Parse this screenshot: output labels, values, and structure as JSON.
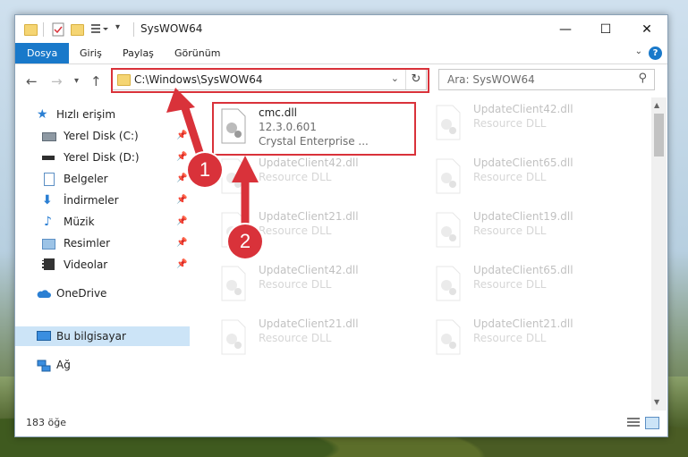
{
  "window": {
    "title": "SysWOW64",
    "buttons": {
      "minimize": "—",
      "maximize": "☐",
      "close": "✕"
    }
  },
  "ribbon": {
    "tabs": [
      "Dosya",
      "Giriş",
      "Paylaş",
      "Görünüm"
    ],
    "help": "?"
  },
  "address": {
    "path": "C:\\Windows\\SysWOW64",
    "search_placeholder": "Ara: SysWOW64"
  },
  "sidebar": {
    "items": [
      {
        "label": "Hızlı erişim",
        "icon": "star-icon",
        "pinned": false
      },
      {
        "label": "Yerel Disk (C:)",
        "icon": "drive-icon",
        "pinned": true
      },
      {
        "label": "Yerel Disk (D:)",
        "icon": "drive-icon",
        "pinned": true
      },
      {
        "label": "Belgeler",
        "icon": "documents-icon",
        "pinned": true
      },
      {
        "label": "İndirmeler",
        "icon": "downloads-icon",
        "pinned": true
      },
      {
        "label": "Müzik",
        "icon": "music-icon",
        "pinned": true
      },
      {
        "label": "Resimler",
        "icon": "pictures-icon",
        "pinned": true
      },
      {
        "label": "Videolar",
        "icon": "videos-icon",
        "pinned": true
      },
      {
        "label": "OneDrive",
        "icon": "cloud-icon",
        "pinned": false
      },
      {
        "label": "Bu bilgisayar",
        "icon": "computer-icon",
        "pinned": false
      },
      {
        "label": "Ağ",
        "icon": "network-icon",
        "pinned": false
      }
    ]
  },
  "files": {
    "highlighted": {
      "name": "cmc.dll",
      "version": "12.3.0.601",
      "desc": "Crystal Enterprise ..."
    },
    "items": [
      {
        "name": "UpdateClient42.dll",
        "desc": "Resource DLL"
      },
      {
        "name": "UpdateClient42.dll",
        "desc": "Resource DLL"
      },
      {
        "name": "UpdateClient65.dll",
        "desc": "Resource DLL"
      },
      {
        "name": "UpdateClient21.dll",
        "desc": "Resource DLL"
      },
      {
        "name": "UpdateClient19.dll",
        "desc": "Resource DLL"
      },
      {
        "name": "UpdateClient42.dll",
        "desc": "Resource DLL"
      },
      {
        "name": "UpdateClient65.dll",
        "desc": "Resource DLL"
      },
      {
        "name": "UpdateClient21.dll",
        "desc": "Resource DLL"
      },
      {
        "name": "UpdateClient21.dll",
        "desc": "Resource DLL"
      }
    ]
  },
  "status": {
    "count": "183 öğe"
  },
  "annotations": {
    "step1": "1",
    "step2": "2",
    "color": "#d9323a"
  }
}
